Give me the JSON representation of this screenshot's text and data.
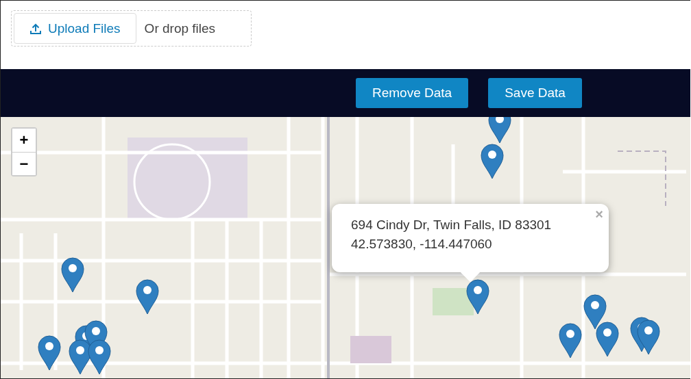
{
  "upload": {
    "button": "Upload Files",
    "hint": "Or drop files"
  },
  "toolbar": {
    "buttons": [
      "Remove Data",
      "Save Data"
    ]
  },
  "map": {
    "zoom_in": "+",
    "zoom_out": "−",
    "popup": {
      "address": "694 Cindy Dr, Twin Falls, ID 83301",
      "coordinates": "42.573830, -114.447060",
      "close": "×"
    }
  }
}
